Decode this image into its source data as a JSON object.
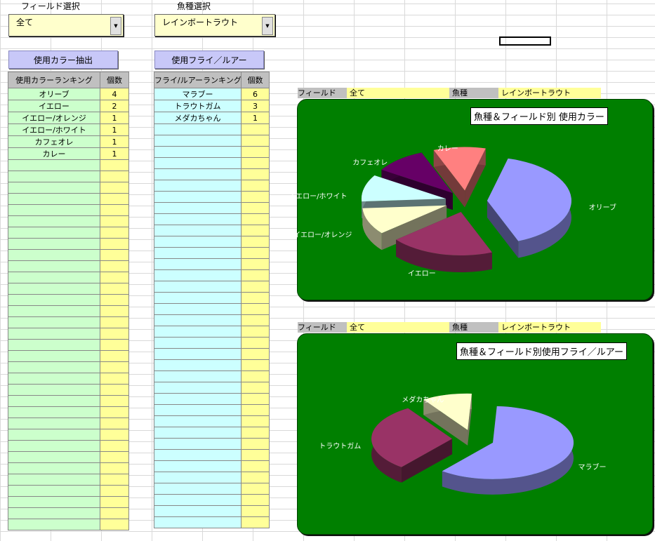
{
  "field_select": {
    "label": "フィールド選択",
    "value": "全て"
  },
  "species_select": {
    "label": "魚種選択",
    "value": "レインボートラウト"
  },
  "buttons": {
    "extract_color": "使用カラー抽出",
    "extract_fly": "使用フライ／ルアー"
  },
  "color_table": {
    "col_name": "使用カラーランキング",
    "col_count": "個数",
    "rows": [
      {
        "name": "オリーブ",
        "count": "4"
      },
      {
        "name": "イエロー",
        "count": "2"
      },
      {
        "name": "イエロー/オレンジ",
        "count": "1"
      },
      {
        "name": "イエロー/ホワイト",
        "count": "1"
      },
      {
        "name": "カフェオレ",
        "count": "1"
      },
      {
        "name": "カレー",
        "count": "1"
      }
    ]
  },
  "fly_table": {
    "col_name": "フライ/ルアーランキング",
    "col_count": "個数",
    "rows": [
      {
        "name": "マラブー",
        "count": "6"
      },
      {
        "name": "トラウトガム",
        "count": "3"
      },
      {
        "name": "メダカちゃん",
        "count": "1"
      }
    ]
  },
  "chart1_header": {
    "field_label": "フィールド",
    "field_value": "全て",
    "species_label": "魚種",
    "species_value": "レインボートラウト"
  },
  "chart2_header": {
    "field_label": "フィールド",
    "field_value": "全て",
    "species_label": "魚種",
    "species_value": "レインボートラウト"
  },
  "chart_data": [
    {
      "type": "pie",
      "title": "魚種＆フィールド別 使用カラー",
      "categories": [
        "オリーブ",
        "イエロー",
        "イエロー/オレンジ",
        "イエロー/ホワイト",
        "カフェオレ",
        "カレー"
      ],
      "values": [
        4,
        2,
        1,
        1,
        1,
        1
      ],
      "colors": [
        "#9999ff",
        "#993366",
        "#ffffcc",
        "#ccffff",
        "#660066",
        "#ff8080"
      ]
    },
    {
      "type": "pie",
      "title": "魚種＆フィールド別使用フライ／ルアー",
      "categories": [
        "マラブー",
        "トラウトガム",
        "メダカちゃん"
      ],
      "values": [
        6,
        3,
        1
      ],
      "colors": [
        "#9999ff",
        "#993366",
        "#ffffcc"
      ]
    }
  ]
}
